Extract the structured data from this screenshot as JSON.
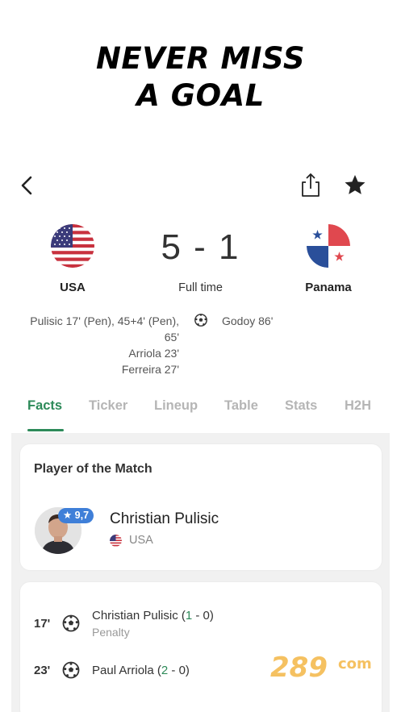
{
  "headline": {
    "line1": "NEVER MISS",
    "line2": "A GOAL"
  },
  "match": {
    "home": {
      "name": "USA"
    },
    "away": {
      "name": "Panama"
    },
    "score": "5 - 1",
    "status": "Full time",
    "home_scorers": [
      "Pulisic 17' (Pen), 45+4' (Pen),",
      "65'",
      "Arriola 23'",
      "Ferreira 27'"
    ],
    "away_scorers": [
      "Godoy 86'"
    ]
  },
  "tabs": [
    {
      "label": "Facts",
      "active": true
    },
    {
      "label": "Ticker"
    },
    {
      "label": "Lineup"
    },
    {
      "label": "Table"
    },
    {
      "label": "Stats"
    },
    {
      "label": "H2H"
    }
  ],
  "potm": {
    "title": "Player of the Match",
    "rating": "★ 9,7",
    "player": "Christian Pulisic",
    "team": "USA"
  },
  "events": [
    {
      "minute": "17'",
      "player": "Christian Pulisic",
      "score_home": "1",
      "score_sep": " - 0)",
      "detail": "Penalty"
    },
    {
      "minute": "23'",
      "player": "Paul Arriola",
      "score_home": "2",
      "score_sep": " - 0)"
    }
  ],
  "watermark": {
    "text": "289",
    "suffix": "com"
  },
  "colors": {
    "accent": "#2d8a59",
    "badge": "#3f7fd8",
    "tab_inactive": "#b5b5b5"
  }
}
